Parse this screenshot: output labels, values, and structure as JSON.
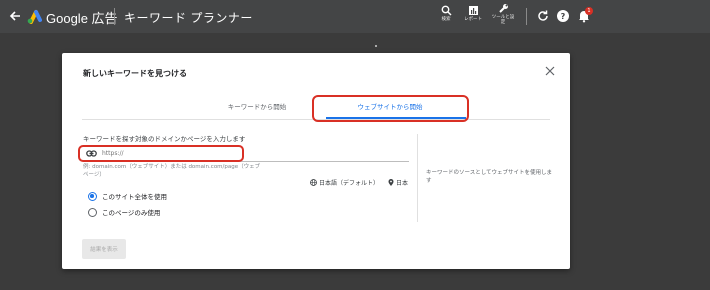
{
  "header": {
    "brand": "Google 広告",
    "title": "キーワード プランナー",
    "tools": [
      {
        "label": "検索",
        "icon": "search-icon"
      },
      {
        "label": "レポート",
        "icon": "reports-icon"
      },
      {
        "label": "ツールと設定",
        "icon": "wrench-icon"
      }
    ],
    "notification_count": "1"
  },
  "dialog": {
    "title": "新しいキーワードを見つける",
    "tabs": [
      {
        "label": "キーワードから開始",
        "active": false
      },
      {
        "label": "ウェブサイトから開始",
        "active": true
      }
    ],
    "prompt": "キーワードを探す対象のドメインかページを入力します",
    "url_input": {
      "value": "",
      "placeholder": "https://"
    },
    "example": "例: domain.com（ウェブサイト）または domain.com/page（ウェブページ）",
    "language": "日本語（デフォルト）",
    "location": "日本",
    "radios": [
      {
        "label": "このサイト全体を使用",
        "selected": true
      },
      {
        "label": "このページのみ使用",
        "selected": false
      }
    ],
    "side_note": "キーワードのソースとしてウェブサイトを使用します",
    "submit_label": "結果を表示"
  },
  "colors": {
    "accent": "#1a73e8",
    "highlight": "#d93025",
    "topbar": "#444546"
  }
}
